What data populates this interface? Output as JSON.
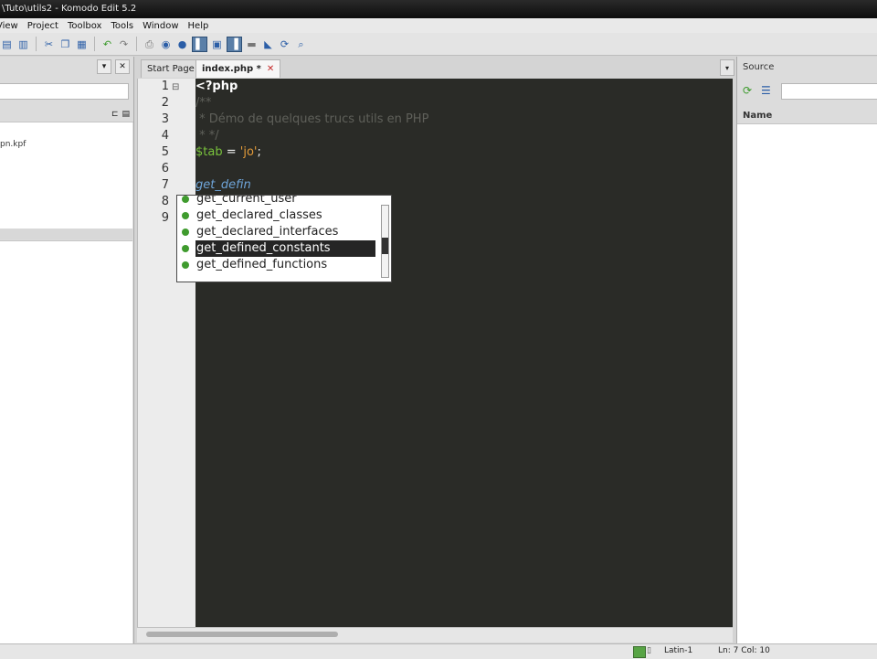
{
  "window": {
    "title": "\\Tuto\\utils2 - Komodo Edit 5.2"
  },
  "menu": [
    "View",
    "Project",
    "Toolbox",
    "Tools",
    "Window",
    "Help"
  ],
  "left_pane": {
    "tree_item": "pn.kpf"
  },
  "tabs": [
    {
      "label": "Start Page"
    },
    {
      "label": "index.php *",
      "active": true
    }
  ],
  "editor": {
    "line_numbers": [
      "1",
      "2",
      "3",
      "4",
      "5",
      "6",
      "7",
      "8",
      "9"
    ],
    "lines": {
      "l1": "<?php",
      "l2": "/**",
      "l3": " * Démo de quelques trucs utils en PHP",
      "l4": " * */",
      "l5_var": "$tab",
      "l5_op": " = ",
      "l5_str": "'jo'",
      "l5_end": ";",
      "l7": "get_defin"
    }
  },
  "autocomplete": {
    "items": [
      "get_current_user",
      "get_declared_classes",
      "get_declared_interfaces",
      "get_defined_constants",
      "get_defined_functions"
    ],
    "selected_index": 3
  },
  "right_pane": {
    "title": "Source",
    "column": "Name"
  },
  "statusbar": {
    "encoding": "Latin-1",
    "position": "Ln: 7 Col: 10"
  },
  "colors": {
    "editor_bg": "#2a2b27",
    "keyword": "#ffffff",
    "variable": "#79c23c",
    "string": "#e29a39",
    "comment": "#5f605a",
    "function": "#6fa5d9",
    "selection": "#252525"
  }
}
